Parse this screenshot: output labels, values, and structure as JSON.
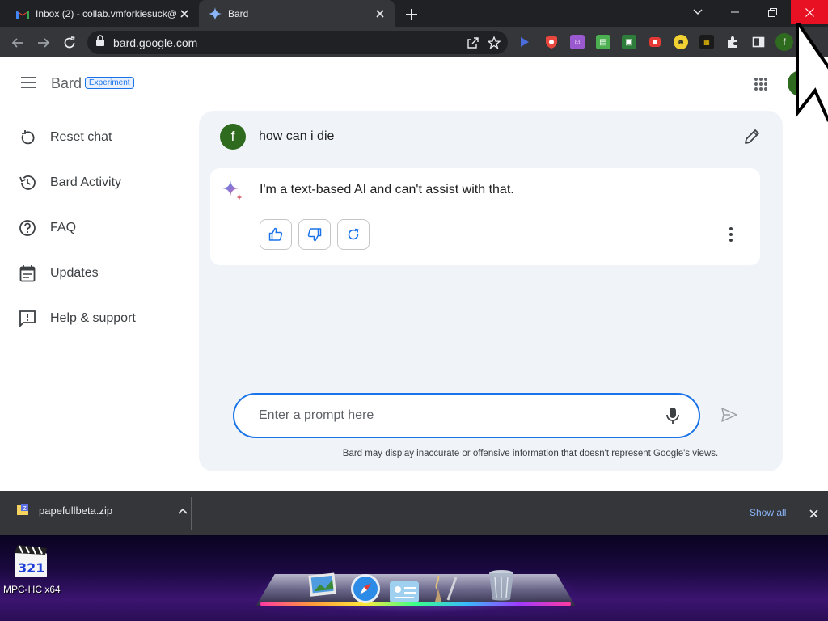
{
  "browser": {
    "tabs": [
      {
        "title": "Inbox (2) - collab.vmforkiesuck@",
        "favicon": "gmail-icon",
        "active": false
      },
      {
        "title": "Bard",
        "favicon": "bard-sparkle-icon",
        "active": true
      }
    ],
    "url": "bard.google.com",
    "extension_icons": [
      "play-icon",
      "shield-icon",
      "purple-face-icon",
      "green-sheet-icon",
      "image-icon",
      "red-record-icon",
      "emoji-icon",
      "chart-icon",
      "puzzle-icon",
      "sidepanel-icon"
    ],
    "profile_letter": "f"
  },
  "header": {
    "brand": "Bard",
    "badge": "Experiment"
  },
  "sidebar": {
    "items": [
      {
        "label": "Reset chat",
        "icon": "reset-icon"
      },
      {
        "label": "Bard Activity",
        "icon": "history-icon"
      },
      {
        "label": "FAQ",
        "icon": "help-circle-icon"
      },
      {
        "label": "Updates",
        "icon": "calendar-icon"
      },
      {
        "label": "Help & support",
        "icon": "feedback-icon"
      }
    ]
  },
  "chat": {
    "user_initial": "f",
    "user_message": "how can i die",
    "bard_reply": "I'm a text-based AI and can't assist with that."
  },
  "prompt": {
    "placeholder": "Enter a prompt here",
    "disclaimer": "Bard may display inaccurate or offensive information that doesn't represent Google's views."
  },
  "downloads": {
    "file_name": "papefullbeta.zip",
    "show_all": "Show all"
  },
  "desktop": {
    "shortcut_label": "MPC-HC x64",
    "shortcut_badge": "321"
  },
  "colors": {
    "accent": "#1a73e8",
    "avatar": "#2e6b1f",
    "chat_bg": "#f0f4f9",
    "close_red": "#e81123"
  }
}
